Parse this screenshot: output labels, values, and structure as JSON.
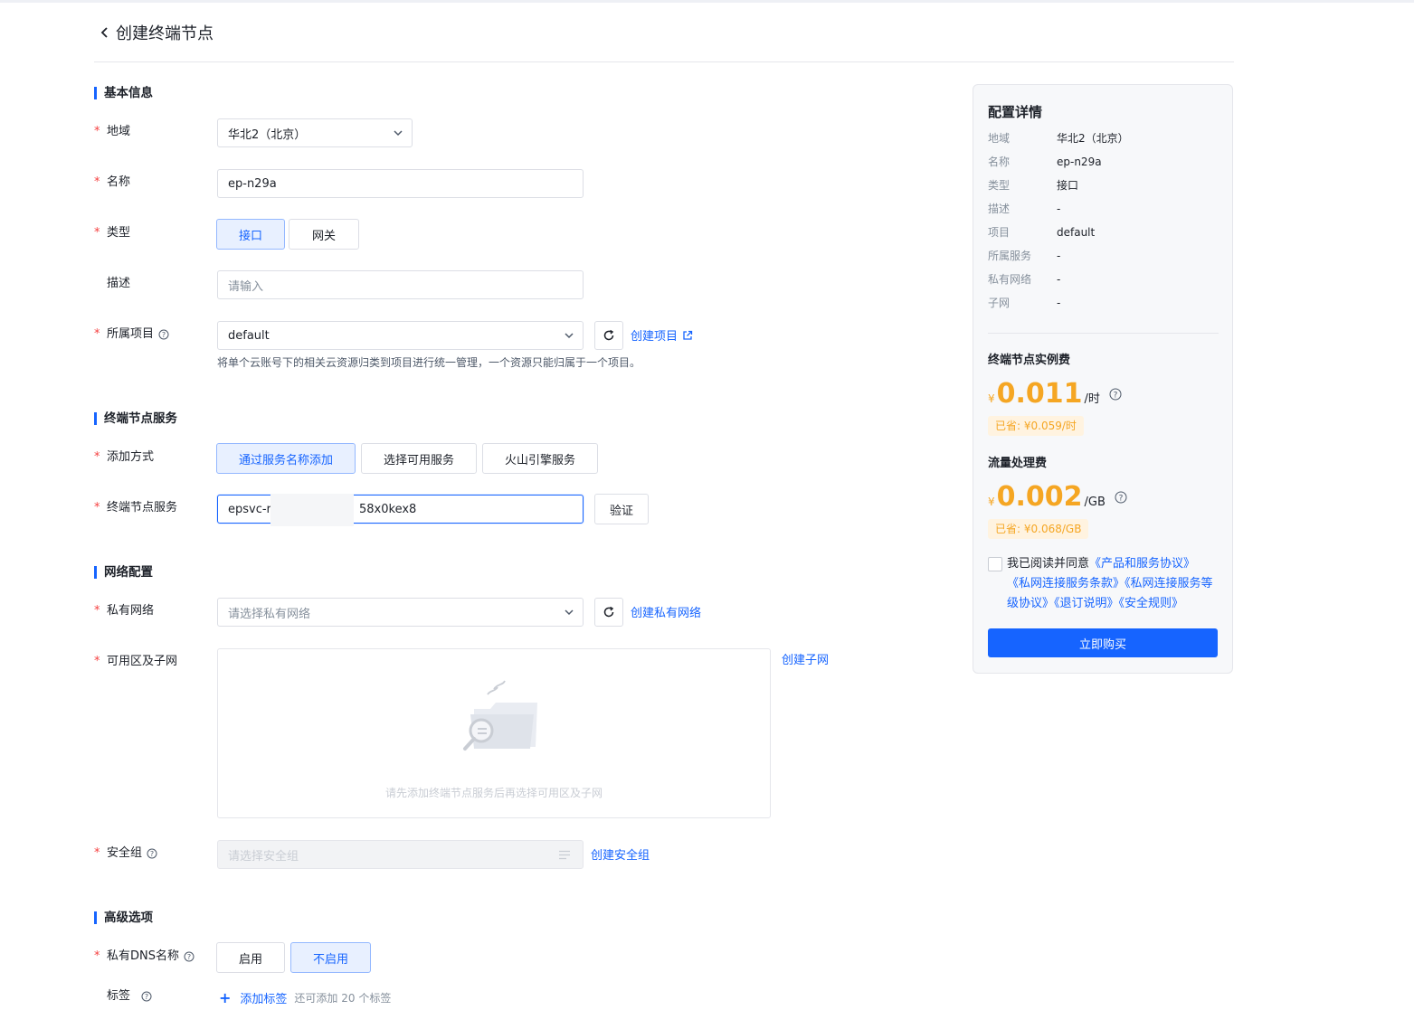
{
  "page": {
    "title": "创建终端节点"
  },
  "sections": {
    "basic": "基本信息",
    "service": "终端节点服务",
    "network": "网络配置",
    "advanced": "高级选项"
  },
  "basic": {
    "region_label": "地域",
    "region_value": "华北2（北京）",
    "name_label": "名称",
    "name_value": "ep-n29a",
    "type_label": "类型",
    "type_options": [
      "接口",
      "网关"
    ],
    "type_selected": "接口",
    "desc_label": "描述",
    "desc_placeholder": "请输入",
    "project_label": "所属项目",
    "project_value": "default",
    "create_project_link": "创建项目",
    "project_hint": "将单个云账号下的相关云资源归类到项目进行统一管理，一个资源只能归属于一个项目。"
  },
  "service": {
    "method_label": "添加方式",
    "method_options": [
      "通过服务名称添加",
      "选择可用服务",
      "火山引擎服务"
    ],
    "method_selected": "通过服务名称添加",
    "service_label": "终端节点服务",
    "service_value_prefix": "epsvc-rr",
    "service_value_suffix": "58x0kex8",
    "verify_button": "验证"
  },
  "network": {
    "vpc_label": "私有网络",
    "vpc_placeholder": "请选择私有网络",
    "create_vpc_link": "创建私有网络",
    "subnet_label": "可用区及子网",
    "create_subnet_link": "创建子网",
    "subnet_empty_text": "请先添加终端节点服务后再选择可用区及子网",
    "sg_label": "安全组",
    "sg_placeholder": "请选择安全组",
    "create_sg_link": "创建安全组"
  },
  "advanced": {
    "dns_label": "私有DNS名称",
    "dns_options": [
      "启用",
      "不启用"
    ],
    "dns_selected": "不启用",
    "tag_label": "标签",
    "add_tag_link": "添加标签",
    "tag_hint": "还可添加 20 个标签"
  },
  "sidebar": {
    "title": "配置详情",
    "details": [
      {
        "key": "地域",
        "value": "华北2（北京）"
      },
      {
        "key": "名称",
        "value": "ep-n29a"
      },
      {
        "key": "类型",
        "value": "接口"
      },
      {
        "key": "描述",
        "value": "-"
      },
      {
        "key": "项目",
        "value": "default"
      },
      {
        "key": "所属服务",
        "value": "-"
      },
      {
        "key": "私有网络",
        "value": "-"
      },
      {
        "key": "子网",
        "value": "-"
      }
    ],
    "instance_fee_title": "终端节点实例费",
    "instance_fee": {
      "currency": "¥",
      "amount": "0.011",
      "unit": "/时",
      "saved": "已省: ¥0.059/时"
    },
    "traffic_fee_title": "流量处理费",
    "traffic_fee": {
      "currency": "¥",
      "amount": "0.002",
      "unit": "/GB",
      "saved": "已省: ¥0.068/GB"
    },
    "agree_prefix": "我已阅读并同意",
    "agree_links": [
      "《产品和服务协议》",
      "《私网连接服务条款》",
      "《私网连接服务等级协议》",
      "《退订说明》",
      "《安全规则》"
    ],
    "buy_button": "立即购买"
  },
  "colors": {
    "primary": "#1664ff",
    "price": "#f5a623",
    "required": "#f53f3f"
  }
}
